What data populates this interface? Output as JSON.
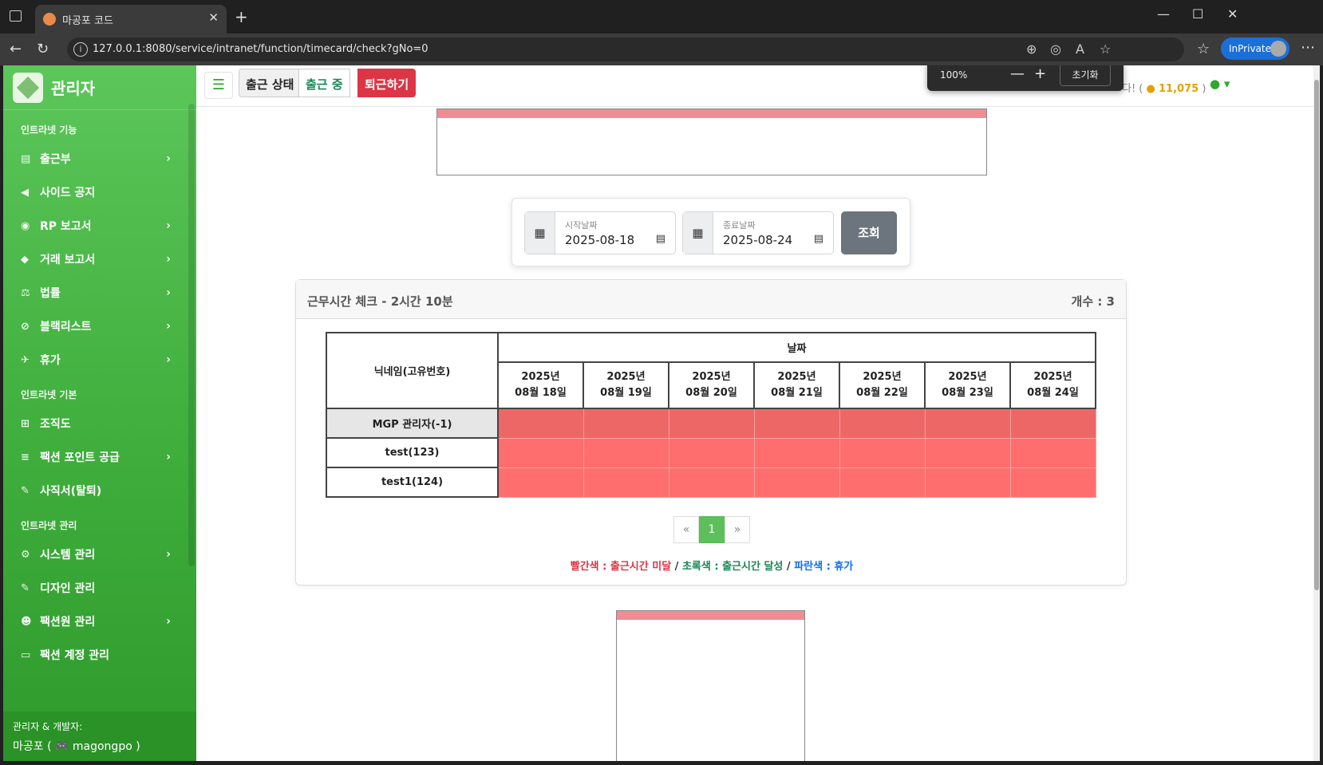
{
  "browser": {
    "tab_title": "마공포 코드",
    "url": "127.0.0.1:8080/service/intranet/function/timecard/check?gNo=0",
    "inprivate": "InPrivate",
    "zoom": "100%",
    "zoom_reset": "초기화"
  },
  "sidebar": {
    "brand": "관리자",
    "sections": [
      {
        "title": "인트라넷 기능",
        "items": [
          {
            "label": "출근부",
            "icon": "book-icon",
            "chevron": true
          },
          {
            "label": "사이드 공지",
            "icon": "megaphone-icon",
            "chevron": false
          },
          {
            "label": "RP 보고서",
            "icon": "gamepad-icon",
            "chevron": true
          },
          {
            "label": "거래 보고서",
            "icon": "money-bag-icon",
            "chevron": true
          },
          {
            "label": "법률",
            "icon": "scale-icon",
            "chevron": true
          },
          {
            "label": "블랙리스트",
            "icon": "ban-icon",
            "chevron": true
          },
          {
            "label": "휴가",
            "icon": "plane-icon",
            "chevron": true
          }
        ]
      },
      {
        "title": "인트라넷 기본",
        "items": [
          {
            "label": "조직도",
            "icon": "sitemap-icon",
            "chevron": false
          },
          {
            "label": "팩션 포인트 공급",
            "icon": "coins-icon",
            "chevron": true
          },
          {
            "label": "사직서(탈퇴)",
            "icon": "feather-icon",
            "chevron": false
          }
        ]
      },
      {
        "title": "인트라넷 관리",
        "items": [
          {
            "label": "시스템 관리",
            "icon": "gear-icon",
            "chevron": true
          },
          {
            "label": "디자인 관리",
            "icon": "brush-icon",
            "chevron": false
          },
          {
            "label": "팩션원 관리",
            "icon": "user-gear-icon",
            "chevron": true
          },
          {
            "label": "팩션 계정 관리",
            "icon": "id-card-icon",
            "chevron": false
          }
        ]
      }
    ],
    "footer_line1": "관리자 & 개발자:",
    "footer_line2": "마공포 ( 🎮 magongpo )"
  },
  "topbar": {
    "status_label": "출근 상태",
    "status_value": "출근 중",
    "leave_button": "퇴근하기",
    "greeting_tail": "다! (",
    "points": "11,075",
    "points_close": ")"
  },
  "datepicker": {
    "start_label": "시작날짜",
    "start_value": "2025-08-18",
    "end_label": "종료날짜",
    "end_value": "2025-08-24",
    "search_button": "조회"
  },
  "card": {
    "title": "근무시간 체크 - 2시간 10분",
    "count": "개수 : 3",
    "col_nickname": "닉네임(고유번호)",
    "col_date": "날짜",
    "dates": [
      [
        "2025년",
        "08월 18일"
      ],
      [
        "2025년",
        "08월 19일"
      ],
      [
        "2025년",
        "08월 20일"
      ],
      [
        "2025년",
        "08월 21일"
      ],
      [
        "2025년",
        "08월 22일"
      ],
      [
        "2025년",
        "08월 23일"
      ],
      [
        "2025년",
        "08월 24일"
      ]
    ],
    "rows": [
      "MGP 관리자(-1)",
      "test(123)",
      "test1(124)"
    ],
    "pager": {
      "prev": "«",
      "current": "1",
      "next": "»"
    },
    "legend": {
      "red": "빨간색 : 출근시간 미달",
      "sep1": " / ",
      "green": "초록색 : 출근시간 달성",
      "sep2": " / ",
      "blue": "파란색 : 휴가"
    }
  },
  "colors": {
    "accent_green": "#4cbb4a",
    "danger": "#dc3545",
    "cell_red": "#ff6e6e"
  }
}
